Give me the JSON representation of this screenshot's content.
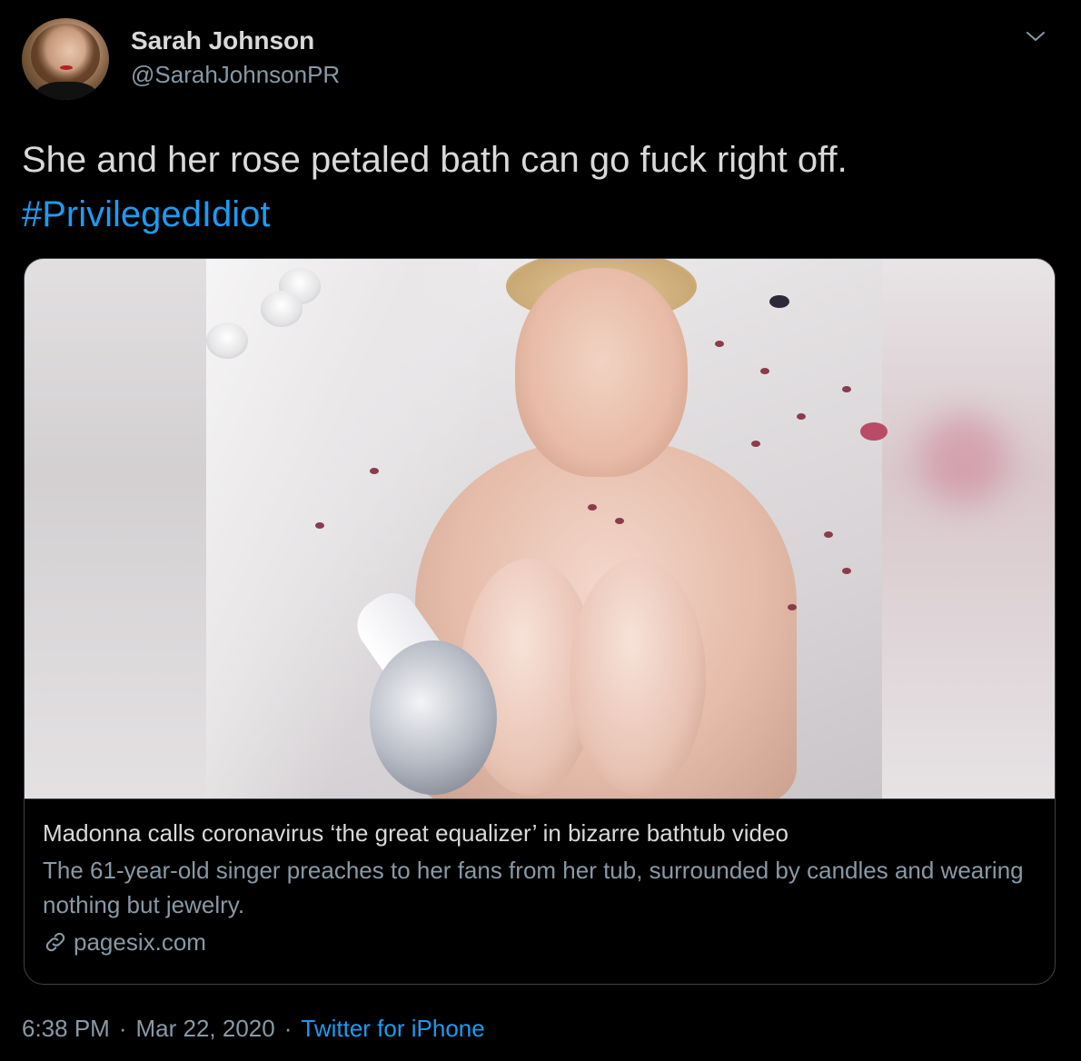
{
  "author": {
    "display_name": "Sarah Johnson",
    "handle": "@SarahJohnsonPR"
  },
  "tweet": {
    "text": "She and her rose petaled bath can go fuck right off.",
    "hashtag": "#PrivilegedIdiot"
  },
  "card": {
    "title": "Madonna calls coronavirus ‘the great equalizer’ in bizarre bathtub video",
    "description": "The 61-year-old singer preaches to her fans from her tub, surrounded by candles and wearing nothing but jewelry.",
    "domain": "pagesix.com",
    "icon": "link-icon"
  },
  "meta": {
    "time": "6:38 PM",
    "separator": "·",
    "date": "Mar 22, 2020",
    "source": "Twitter for iPhone"
  },
  "colors": {
    "background": "#000000",
    "text": "#d9d9d9",
    "secondary": "#8899a6",
    "link": "#1d9bf0",
    "border": "#3d4348"
  },
  "icons": {
    "caret": "chevron-down-icon",
    "link": "link-icon"
  }
}
